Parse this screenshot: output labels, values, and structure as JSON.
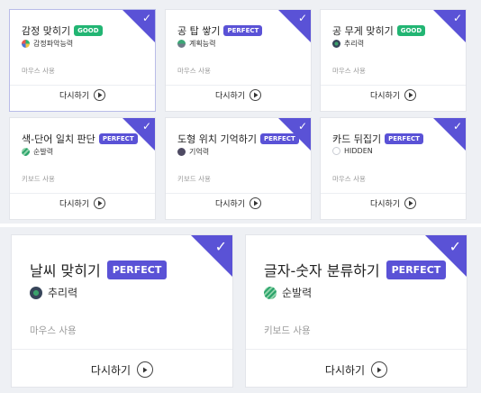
{
  "colors": {
    "accent": "#5a52d6",
    "good": "#22b573",
    "panel_background": "#eef0f4"
  },
  "top_cards": [
    {
      "title": "감정 맞히기",
      "badge": "GOOD",
      "badge_type": "good",
      "skill": "감정파악능력",
      "skill_icon": "emotion-skill-icon",
      "input": "마우스 사용",
      "retry": "다시하기",
      "selected": true
    },
    {
      "title": "공 탑 쌓기",
      "badge": "PERFECT",
      "badge_type": "perfect",
      "skill": "계획능력",
      "skill_icon": "planning-skill-icon",
      "input": "마우스 사용",
      "retry": "다시하기"
    },
    {
      "title": "공 무게 맞히기",
      "badge": "GOOD",
      "badge_type": "good",
      "skill": "추리력",
      "skill_icon": "reasoning-skill-icon",
      "input": "마우스 사용",
      "retry": "다시하기"
    },
    {
      "title": "색-단어 일치 판단",
      "badge": "PERFECT",
      "badge_type": "perfect",
      "skill": "순발력",
      "skill_icon": "agility-skill-icon",
      "input": "키보드 사용",
      "retry": "다시하기"
    },
    {
      "title": "도형 위치 기억하기",
      "badge": "PERFECT",
      "badge_type": "perfect",
      "skill": "기억력",
      "skill_icon": "memory-skill-icon",
      "input": "키보드 사용",
      "retry": "다시하기"
    },
    {
      "title": "카드 뒤집기",
      "badge": "PERFECT",
      "badge_type": "perfect",
      "skill": "HIDDEN",
      "skill_icon": "hidden-skill-icon",
      "input": "마우스 사용",
      "retry": "다시하기"
    }
  ],
  "bottom_cards": [
    {
      "title": "날씨 맞히기",
      "badge": "PERFECT",
      "badge_type": "perfect",
      "skill": "추리력",
      "skill_icon": "reasoning-skill-icon",
      "input": "마우스 사용",
      "retry": "다시하기"
    },
    {
      "title": "글자-숫자 분류하기",
      "badge": "PERFECT",
      "badge_type": "perfect",
      "skill": "순발력",
      "skill_icon": "agility-skill-icon",
      "input": "키보드 사용",
      "retry": "다시하기"
    }
  ]
}
